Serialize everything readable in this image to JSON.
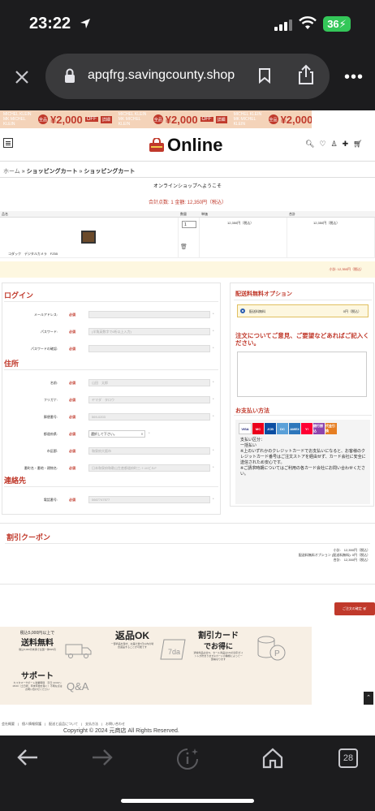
{
  "status_bar": {
    "time": "23:22",
    "battery": "36"
  },
  "browser": {
    "url": "apqfrg.savingcounty.shop",
    "tab_count": "28"
  },
  "banner": {
    "brand_line1": "MICHEL KLEIN",
    "brand_line2": "MK MICHEL KLEIN",
    "badge": "全品",
    "price": "¥2,000",
    "off": "OFF",
    "chip": "詳細"
  },
  "header": {
    "logo": "Online"
  },
  "breadcrumb": {
    "home": "ホーム",
    "sep": " » ",
    "cart": "ショッピングカート",
    "current": "ショッピングカート"
  },
  "welcome": "オンラインショップへようこそ",
  "cart_summary": "合計点数: 1  金額: 12,350円（税込）",
  "cart_table": {
    "headers": [
      "品名",
      "数量",
      "単価",
      "合計"
    ],
    "row": {
      "name": "コダック　デジタルカメラ　FZ55",
      "qty": "1",
      "unit_price": "12,350円（税込）",
      "total": "12,350円（税込）"
    }
  },
  "subtotal": "小計: 12,350円（税込）",
  "login": {
    "title": "ログイン",
    "fields": [
      {
        "label": "メールアドレス:",
        "req": "必須",
        "placeholder": ""
      },
      {
        "label": "パスワード:",
        "req": "必須",
        "placeholder": "(半角英数字で6桁以上入力)"
      },
      {
        "label": "パスワードの確認:",
        "req": "必須",
        "placeholder": ""
      }
    ]
  },
  "address": {
    "title": "住所",
    "fields": [
      {
        "label": "名前:",
        "req": "必須",
        "placeholder": "山田　太郎"
      },
      {
        "label": "フリガナ:",
        "req": "必須",
        "placeholder": "ヤマダ　タロウ"
      },
      {
        "label": "郵便番号:",
        "req": "必須",
        "placeholder": "569-0203"
      },
      {
        "label": "都道府県:",
        "req": "必須",
        "select": "選択して下さい。"
      },
      {
        "label": "市区郡:",
        "req": "必須",
        "placeholder": "和泉府大阪市"
      },
      {
        "label": "番町名・番地・建物名:",
        "req": "必須",
        "placeholder": "日本和泉府和歌山生産都道府町三-7-10ビルF"
      }
    ]
  },
  "contact": {
    "title": "連絡先",
    "fields": [
      {
        "label": "電話番号:",
        "req": "必須",
        "placeholder": "0667747577"
      }
    ]
  },
  "shipping": {
    "title": "配送料無料オプション",
    "option_label": "配送料無料",
    "option_price": "0円（税込）"
  },
  "notes": {
    "title": "注文についてご意見、ご要望などあればご記入ください。"
  },
  "payment": {
    "title": "お支払い方法",
    "cards": [
      "VISA",
      "MC",
      "JCB",
      "DC",
      "AMEX",
      "Y!",
      "銀行振込",
      "代金引換"
    ],
    "text": "支払い区分：\n一括払い\n※上のいずれかのクレジットカードでお支払いになると、お客様のクレジットカード番号はご注文ストアを経由せず、カード会社に安全に送信されため安心です。\n※ご請求時期についてはご利用の各カード会社にお問い合わせください。"
  },
  "coupon": {
    "title": "割引クーポン",
    "subtotal": "小計:　12,350円（税込）",
    "shipping": "配送料無料オプション (配送料無料): 0円（税込）",
    "total": "合計:　12,350円（税込）"
  },
  "order_button": "ご注文の確定",
  "features": {
    "shipping_title_small": "税込5,000円以上で",
    "shipping_title": "送料無料",
    "shipping_sub": "税込5,000円未満で全国一律495円",
    "return_title": "返品OK",
    "return_sub": "一部商品を除き、お届け後7日以内の場合返品することが可能です",
    "return_icon": "7days",
    "discount_title": "割引カード",
    "discount_title2": "でお得に",
    "discount_sub": "通常商品は全%、セール商品は1%の割引ポイントが貯まります※カードの種類によって一部異なります",
    "support_title": "サポート",
    "support_sub": "カスタマーサポート営業時間　平日 10:00〜18:00（土日祝、年末年始を除く）不明な点はお問い合わせください"
  },
  "footer": {
    "links": "会社概要　|　個人情報保護　|　配送と返品について　|　支払方法　|　お問い合わせ",
    "copyright": "Copyright © 2024 元商店 All Rights Reserved."
  }
}
